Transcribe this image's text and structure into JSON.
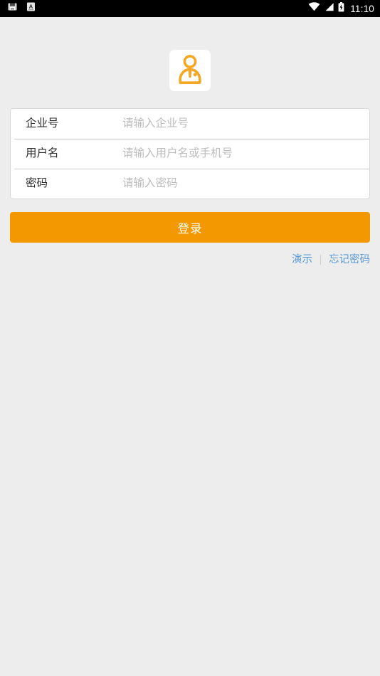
{
  "status_bar": {
    "left_icons": [
      {
        "name": "notification-sd-icon",
        "glyph": "sd-card"
      },
      {
        "name": "input-method-icon",
        "glyph": "A"
      }
    ],
    "right_icons": [
      {
        "name": "wifi-icon",
        "glyph": "wifi"
      },
      {
        "name": "cellular-signal-icon",
        "glyph": "signal"
      },
      {
        "name": "battery-charging-icon",
        "glyph": "battery-bolt"
      }
    ],
    "time": "11:10"
  },
  "logo": {
    "name": "user-avatar-logo",
    "color": "#f5a623",
    "background": "#ffffff"
  },
  "form": {
    "fields": [
      {
        "key": "enterprise",
        "label": "企业号",
        "placeholder": "请输入企业号",
        "value": ""
      },
      {
        "key": "username",
        "label": "用户名",
        "placeholder": "请输入用户名或手机号",
        "value": ""
      },
      {
        "key": "password",
        "label": "密码",
        "placeholder": "请输入密码",
        "value": ""
      }
    ]
  },
  "actions": {
    "login_label": "登录",
    "login_color": "#f39800",
    "demo_label": "演示",
    "forgot_label": "忘记密码",
    "link_color": "#5b9bd5"
  },
  "theme": {
    "page_background": "#ededed",
    "card_background": "#ffffff",
    "label_color": "#2d2d2d",
    "placeholder_color": "#bdbdbd"
  }
}
